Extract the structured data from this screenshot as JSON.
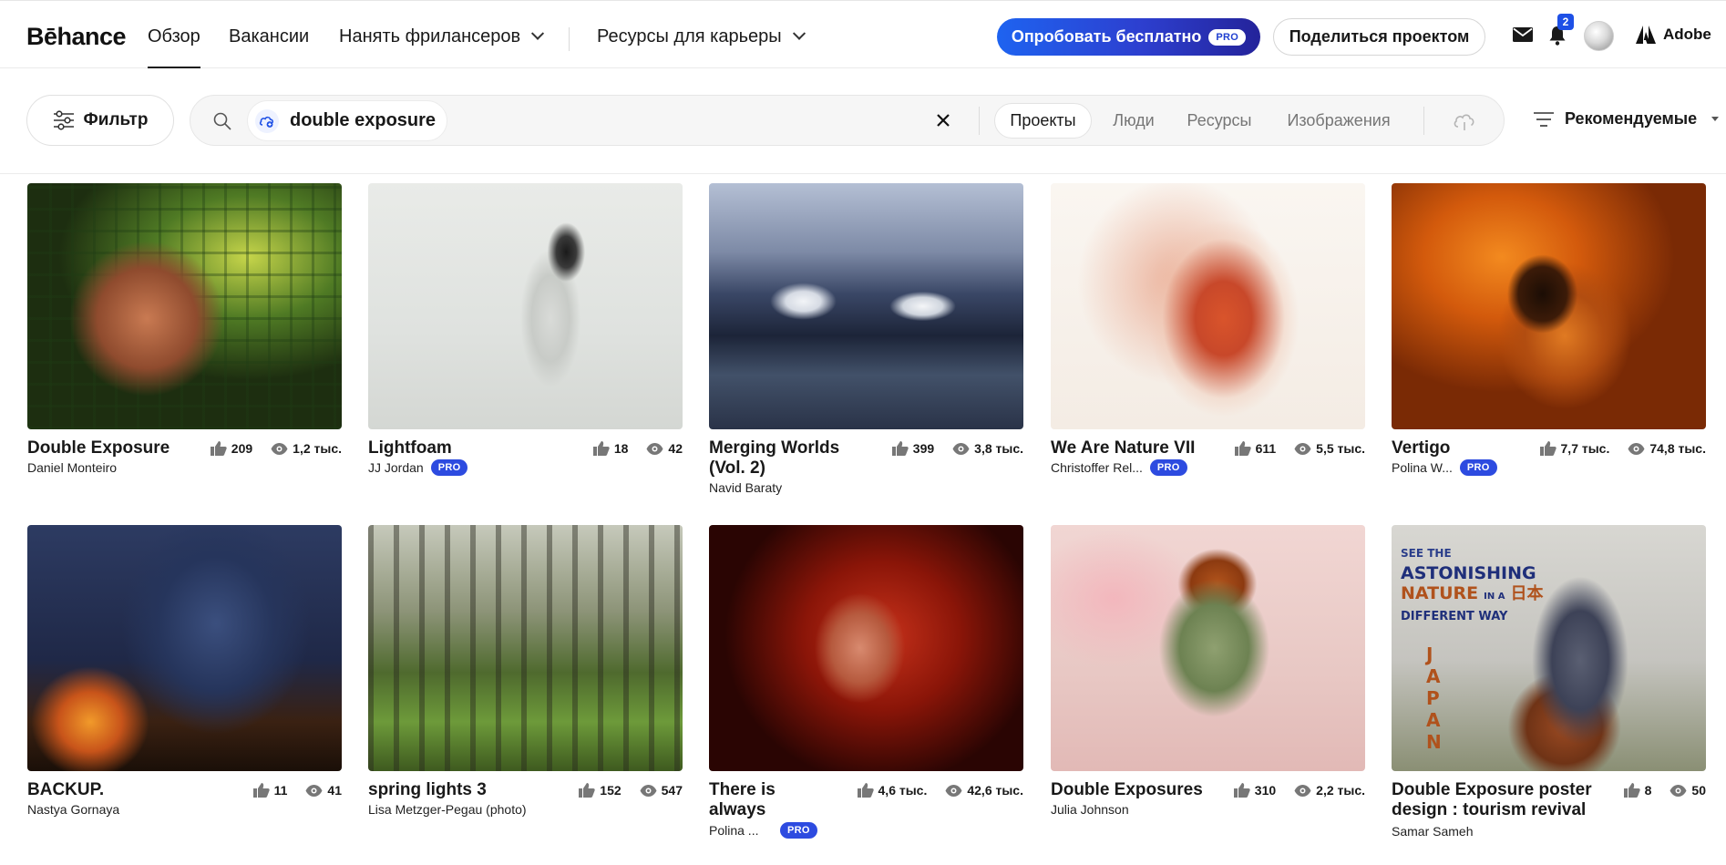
{
  "header": {
    "logo": "Bēhance",
    "nav": [
      {
        "label": "Обзор",
        "active": true
      },
      {
        "label": "Вакансии"
      },
      {
        "label": "Нанять фрилансеров"
      },
      {
        "label": "Ресурсы для карьеры"
      }
    ],
    "try_button": "Опробовать бесплатно",
    "try_badge": "PRO",
    "share_button": "Поделиться проектом",
    "notifications_count": "2",
    "adobe_label": "Adobe"
  },
  "search": {
    "filter_label": "Фильтр",
    "query": "double exposure",
    "tabs": [
      {
        "label": "Проекты",
        "active": true
      },
      {
        "label": "Люди"
      },
      {
        "label": "Ресурсы"
      },
      {
        "label": "Изображения"
      }
    ],
    "sort_label": "Рекомендуемые"
  },
  "colors": {
    "accent_blue": "#1e63f0",
    "pro_badge": "#2d4be0"
  },
  "projects": [
    {
      "title": "Double Exposure",
      "owner": "Daniel Monteiro",
      "likes": "209",
      "views": "1,2 тыс.",
      "pro": ""
    },
    {
      "title": "Lightfoam",
      "owner": "JJ Jordan",
      "likes": "18",
      "views": "42",
      "pro": "PRO"
    },
    {
      "title": "Merging Worlds (Vol. 2)",
      "owner": "Navid Baraty",
      "likes": "399",
      "views": "3,8 тыс.",
      "pro": ""
    },
    {
      "title": "We Are Nature VII",
      "owner": "Christoffer Rel...",
      "likes": "611",
      "views": "5,5 тыс.",
      "pro": "PRO"
    },
    {
      "title": "Vertigo",
      "owner": "Polina W...",
      "likes": "7,7 тыс.",
      "views": "74,8 тыс.",
      "pro": "PRO"
    },
    {
      "title": "BACKUP.",
      "owner": "Nastya Gornaya",
      "likes": "11",
      "views": "41",
      "pro": ""
    },
    {
      "title": "spring lights 3",
      "owner": "Lisa Metzger-Pegau (photo)",
      "likes": "152",
      "views": "547",
      "pro": ""
    },
    {
      "title": "There is always",
      "owner": "Polina ...",
      "likes": "4,6 тыс.",
      "views": "42,6 тыс.",
      "pro": "PRO"
    },
    {
      "title": "Double Exposures",
      "owner": "Julia Johnson",
      "likes": "310",
      "views": "2,2 тыс.",
      "pro": ""
    },
    {
      "title": "Double Exposure poster design : tourism revival",
      "owner": "Samar Sameh",
      "likes": "8",
      "views": "50",
      "pro": ""
    }
  ],
  "poster_text": {
    "line1": "SEE THE",
    "line2": "ASTONISHING",
    "line3": "NATURE",
    "line3b": "IN A",
    "line4": "DIFFERENT WAY",
    "vertical": "JAPAN",
    "kanji": "日本"
  }
}
